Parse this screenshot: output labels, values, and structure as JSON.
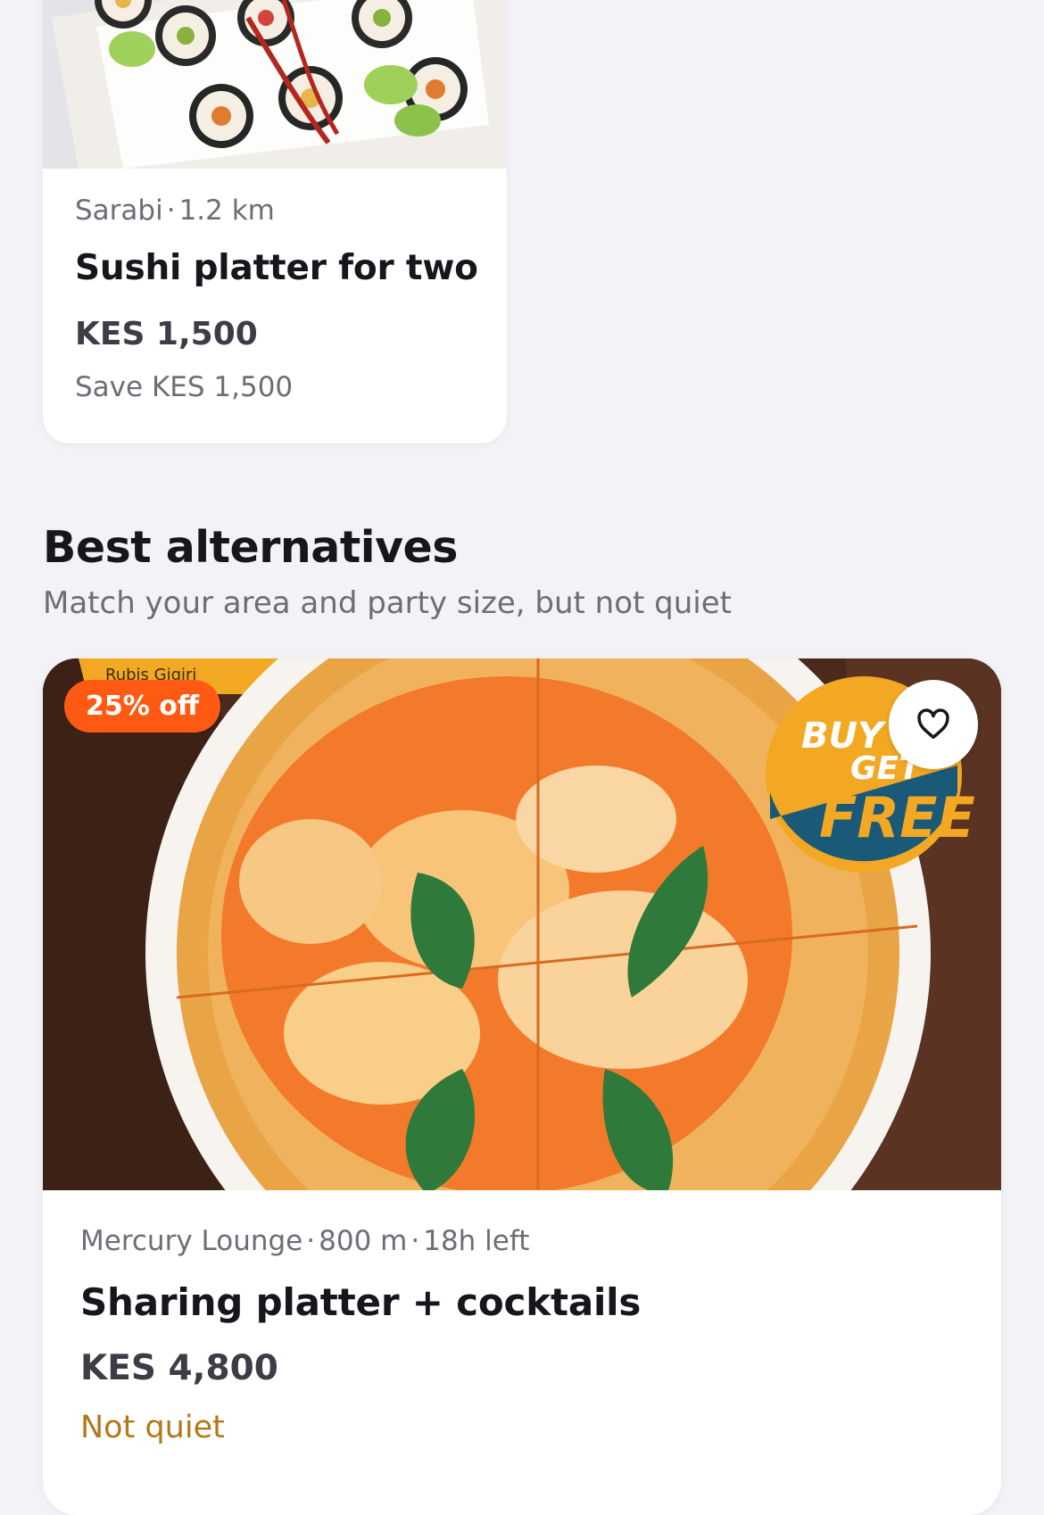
{
  "featured_deal": {
    "venue": "Sarabi",
    "distance": "1.2 km",
    "title": "Sushi platter for two",
    "price": "KES 1,500",
    "savings": "Save KES 1,500",
    "image": "sushi-rolls-photo"
  },
  "alternatives_section": {
    "title": "Best alternatives",
    "subtitle": "Match your area and party size, but not quiet",
    "cards": [
      {
        "badge": "25% off",
        "venue": "Mercury Lounge",
        "distance": "800 m",
        "time_left": "18h left",
        "title": "Sharing platter + cocktails",
        "price": "KES 4,800",
        "warning": "Not quiet",
        "image": "margherita-pizza-photo",
        "promo_text_top": "BUY 1",
        "promo_text_mid": "GET",
        "promo_text_bottom": "FREE",
        "banner_text": "Rubis Gigiri",
        "favorite_icon": "heart-icon"
      }
    ]
  },
  "colors": {
    "background": "#f3f3f7",
    "accent_badge": "#ff5a14",
    "warning_text": "#b3771a",
    "card": "#ffffff"
  }
}
